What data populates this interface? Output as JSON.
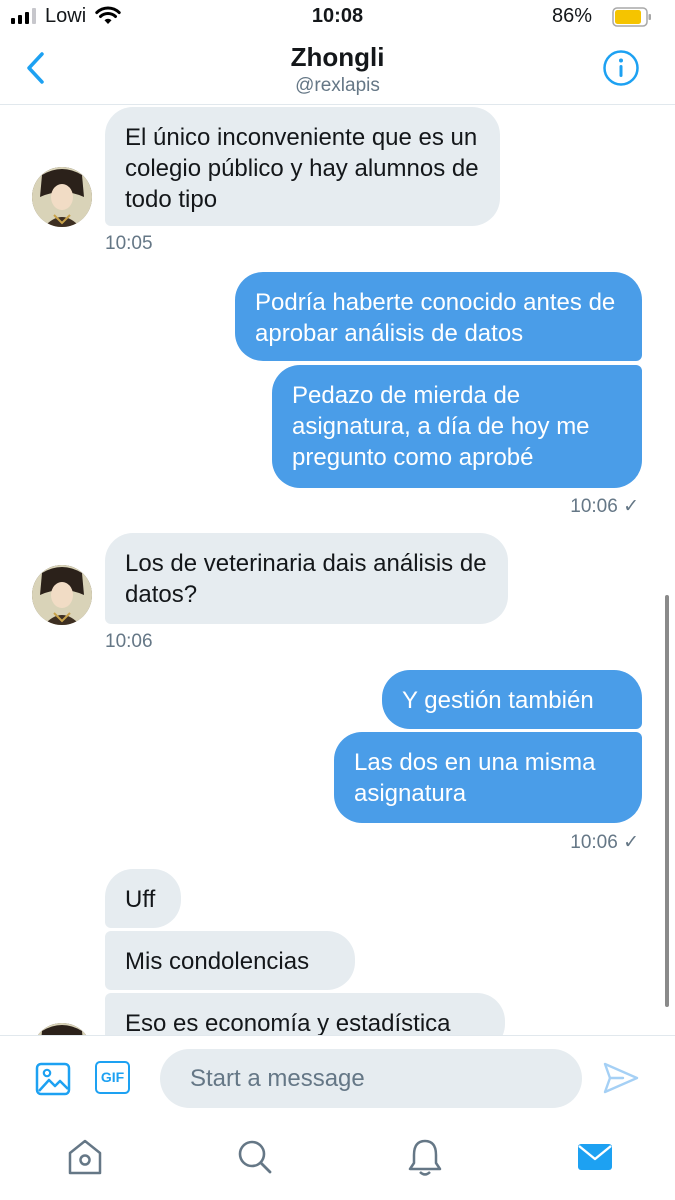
{
  "status_bar": {
    "carrier": "Lowi",
    "time": "10:08",
    "battery": "86%"
  },
  "header": {
    "name": "Zhongli",
    "handle": "@rexlapis"
  },
  "messages": [
    {
      "side": "in",
      "text": "El único inconveniente que es un colegio público y hay alumnos de todo tipo"
    },
    {
      "ts": "10:05"
    },
    {
      "side": "out",
      "text": "Podría haberte conocido antes de aprobar análisis de datos"
    },
    {
      "side": "out",
      "text": "Pedazo de mierda de asignatura, a día de hoy me pregunto como aprobé"
    },
    {
      "ts": "10:06 ✓"
    },
    {
      "side": "in",
      "text": "Los de veterinaria dais análisis de datos?"
    },
    {
      "ts": "10:06"
    },
    {
      "side": "out",
      "text": "Y gestión también"
    },
    {
      "side": "out",
      "text": "Las dos en una misma asignatura"
    },
    {
      "ts": "10:06 ✓"
    },
    {
      "side": "in",
      "text": "Uff"
    },
    {
      "side": "in",
      "text": "Mis condolencias"
    },
    {
      "side": "in",
      "text": "Eso es economía y estadística"
    }
  ],
  "composer": {
    "placeholder": "Start a message",
    "gif_label": "GIF"
  },
  "colors": {
    "accent": "#1da1f2",
    "outgoing_bubble": "#4a9de8",
    "incoming_bubble": "#e6ecf0",
    "battery": "#f5c400"
  },
  "icons": [
    "back-chevron-icon",
    "info-icon",
    "image-icon",
    "gif-icon",
    "send-icon",
    "home-icon",
    "search-icon",
    "notifications-icon",
    "messages-icon"
  ]
}
